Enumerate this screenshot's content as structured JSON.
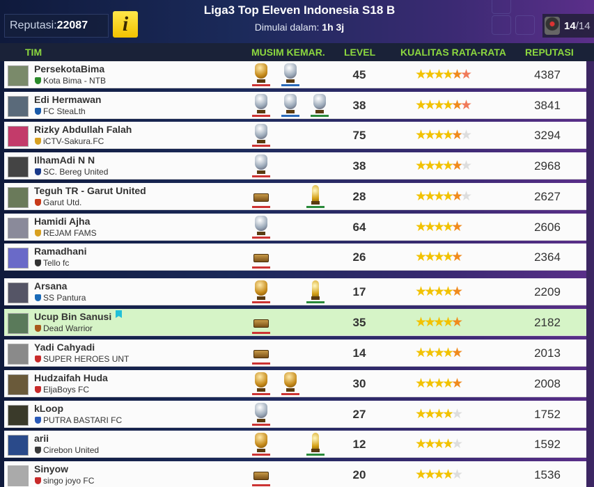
{
  "header": {
    "reputation_label": "Reputasi:",
    "reputation_value": "22087",
    "info_icon": "i",
    "league_title": "Liga3 Top Eleven Indonesia S18 B",
    "start_label": "Dimulai dalam:",
    "start_value": "1h 3j",
    "slots_current": "14",
    "slots_total": "/14"
  },
  "columns": {
    "team": "TIM",
    "last_season": "MUSIM KEMAR.",
    "level": "LEVEL",
    "avg_quality": "KUALITAS RATA-RATA",
    "reputation": "REPUTASI"
  },
  "colors": {
    "header_green": "#8cd83f",
    "row_bg": "#fbfbfb",
    "own_row_bg": "#d6f4c7",
    "star_gold": "#f2c200",
    "star_orange": "#f08a1c"
  },
  "rows": [
    {
      "name": "PersekotaBima",
      "club": "Kota Bima - NTB",
      "level": "45",
      "stars": 5.5,
      "reputation": "4387",
      "trophies": [
        "gold-trophy",
        "silver-trophy"
      ]
    },
    {
      "name": "Edi Hermawan",
      "club": "FC SteaLth",
      "level": "38",
      "stars": 5.5,
      "reputation": "3841",
      "trophies": [
        "silver-trophy",
        "silver-trophy",
        "silver-trophy"
      ]
    },
    {
      "name": "Rizky Abdullah Falah",
      "club": "iCTV-Sakura.FC",
      "level": "75",
      "stars": 5,
      "reputation": "3294",
      "trophies": [
        "silver-trophy"
      ]
    },
    {
      "name": "IlhamAdi N N",
      "club": "SC. Bereg United",
      "level": "38",
      "stars": 5,
      "reputation": "2968",
      "trophies": [
        "silver-trophy"
      ]
    },
    {
      "name": "Teguh TR - Garut United",
      "club": "Garut Utd.",
      "level": "28",
      "stars": 5,
      "reputation": "2627",
      "trophies": [
        "prize-box",
        "gold-cup"
      ]
    },
    {
      "name": "Hamidi Ajha",
      "club": "REJAM FAMS",
      "level": "64",
      "stars": 4.5,
      "reputation": "2606",
      "trophies": [
        "silver-trophy"
      ]
    },
    {
      "name": "Ramadhani",
      "club": "Tello fc",
      "level": "26",
      "stars": 4.5,
      "reputation": "2364",
      "trophies": [
        "prize-box"
      ]
    },
    {
      "name": "Arsana",
      "club": "SS Pantura",
      "level": "17",
      "stars": 4.5,
      "reputation": "2209",
      "trophies": [
        "gold-trophy",
        "gold-cup"
      ]
    },
    {
      "name": "Ucup Bin Sanusi",
      "club": "Dead Warrior",
      "level": "35",
      "stars": 4.5,
      "reputation": "2182",
      "trophies": [
        "prize-box"
      ],
      "own": true
    },
    {
      "name": "Yadi Cahyadi",
      "club": "SUPER HEROES UNT",
      "level": "14",
      "stars": 4.5,
      "reputation": "2013",
      "trophies": [
        "prize-box"
      ]
    },
    {
      "name": "Hudzaifah Huda",
      "club": "EljaBoys FC",
      "level": "30",
      "stars": 4.5,
      "reputation": "2008",
      "trophies": [
        "gold-trophy",
        "gold-trophy"
      ]
    },
    {
      "name": "kLoop",
      "club": "PUTRA BASTARI FC",
      "level": "27",
      "stars": 4,
      "reputation": "1752",
      "trophies": [
        "silver-trophy"
      ]
    },
    {
      "name": "arii",
      "club": "Cirebon United",
      "level": "12",
      "stars": 4,
      "reputation": "1592",
      "trophies": [
        "gold-trophy",
        "gold-cup"
      ]
    },
    {
      "name": "Sinyow",
      "club": "singo joyo FC",
      "level": "20",
      "stars": 4,
      "reputation": "1536",
      "trophies": [
        "prize-box"
      ]
    }
  ]
}
